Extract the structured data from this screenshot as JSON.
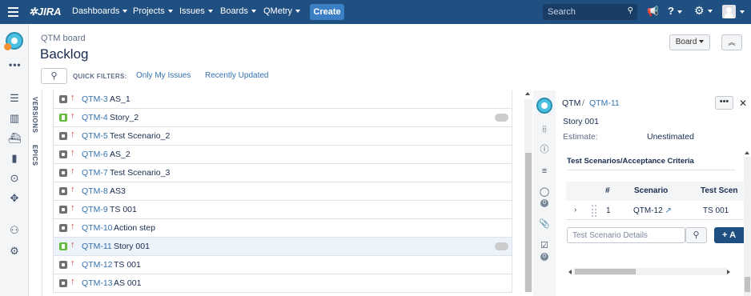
{
  "nav": {
    "logo": "JIRA",
    "items": [
      {
        "label": "Dashboards"
      },
      {
        "label": "Projects"
      },
      {
        "label": "Issues"
      },
      {
        "label": "Boards"
      },
      {
        "label": "QMetry"
      }
    ],
    "create_label": "Create",
    "search_placeholder": "Search",
    "colors": {
      "bar": "#205081",
      "create": "#3b7fc4"
    }
  },
  "header": {
    "breadcrumb": "QTM board",
    "title": "Backlog",
    "board_button": "Board",
    "quick_filters_label": "QUICK FILTERS:",
    "quick_filters": [
      "Only My Issues",
      "Recently Updated"
    ]
  },
  "side_tabs": [
    "VERSIONS",
    "EPICS"
  ],
  "issues": [
    {
      "key": "QTM-3",
      "summary": "AS_1",
      "type": "task"
    },
    {
      "key": "QTM-4",
      "summary": "Story_2",
      "type": "story",
      "estimate": true
    },
    {
      "key": "QTM-5",
      "summary": "Test Scenario_2",
      "type": "task"
    },
    {
      "key": "QTM-6",
      "summary": "AS_2",
      "type": "task"
    },
    {
      "key": "QTM-7",
      "summary": "Test Scenario_3",
      "type": "task"
    },
    {
      "key": "QTM-8",
      "summary": "AS3",
      "type": "task"
    },
    {
      "key": "QTM-9",
      "summary": "TS 001",
      "type": "task"
    },
    {
      "key": "QTM-10",
      "summary": "Action step",
      "type": "task"
    },
    {
      "key": "QTM-11",
      "summary": "Story 001",
      "type": "story",
      "estimate": true,
      "selected": true
    },
    {
      "key": "QTM-12",
      "summary": "TS 001",
      "type": "task"
    },
    {
      "key": "QTM-13",
      "summary": "AS 001",
      "type": "task"
    }
  ],
  "detail": {
    "project": "QTM",
    "separator": "/",
    "issue_key": "QTM-11",
    "title": "Story 001",
    "estimate_label": "Estimate:",
    "estimate_value": "Unestimated",
    "section_title": "Test Scenarios/Acceptance Criteria",
    "table": {
      "headers": [
        "#",
        "Scenario",
        "Test Scen"
      ],
      "rows": [
        {
          "num": "1",
          "scenario": "QTM-12",
          "test": "TS 001"
        }
      ]
    },
    "input_placeholder": "Test Scenario Details",
    "add_label": "+ A",
    "badges": [
      "0",
      "0"
    ]
  }
}
